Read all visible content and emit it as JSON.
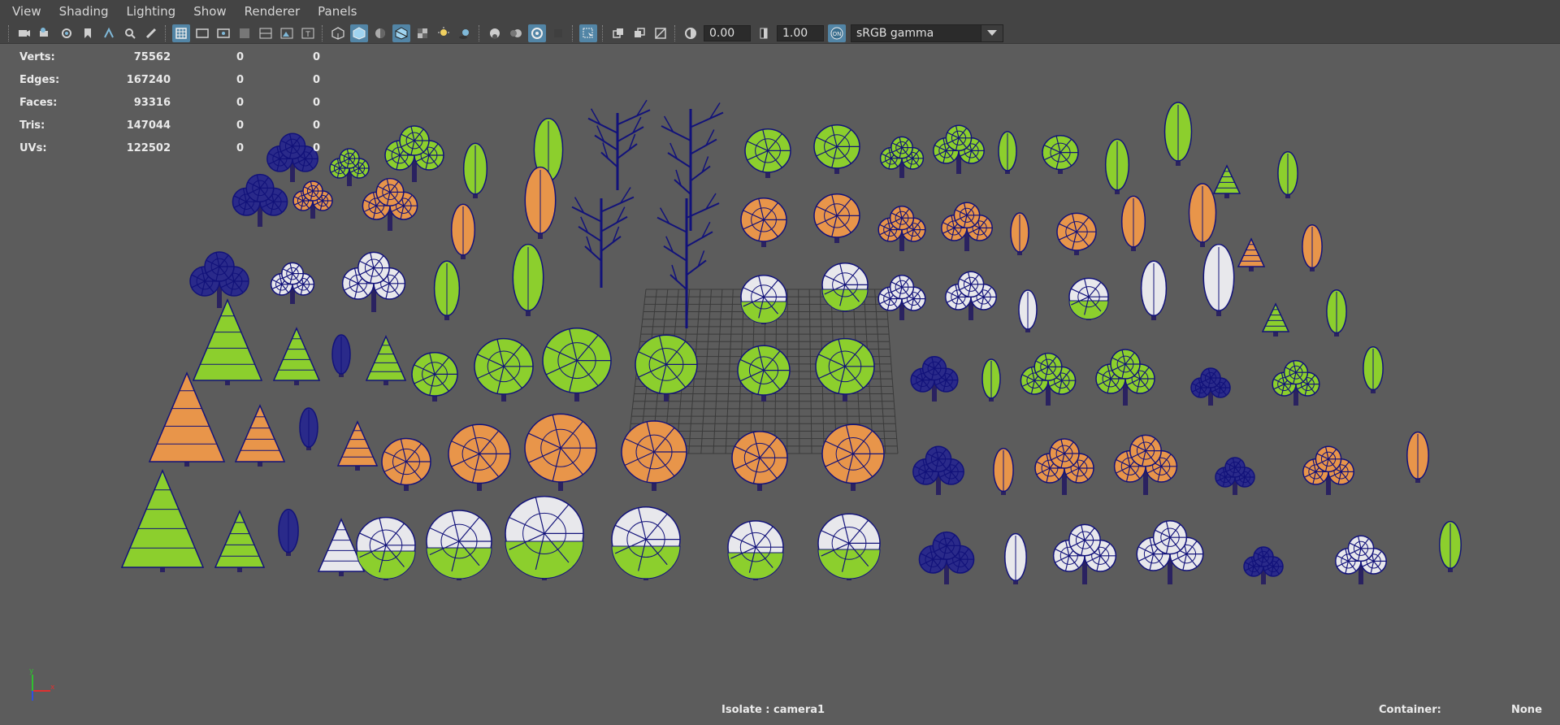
{
  "menu": [
    "View",
    "Shading",
    "Lighting",
    "Show",
    "Renderer",
    "Panels"
  ],
  "toolbar": {
    "exposure_value": "0.00",
    "gamma_value": "1.00",
    "colorspace_label": "sRGB gamma"
  },
  "hud": {
    "rows": [
      {
        "label": "Verts:",
        "v1": "75562",
        "v2": "0",
        "v3": "0"
      },
      {
        "label": "Edges:",
        "v1": "167240",
        "v2": "0",
        "v3": "0"
      },
      {
        "label": "Faces:",
        "v1": "93316",
        "v2": "0",
        "v3": "0"
      },
      {
        "label": "Tris:",
        "v1": "147044",
        "v2": "0",
        "v3": "0"
      },
      {
        "label": "UVs:",
        "v1": "122502",
        "v2": "0",
        "v3": "0"
      }
    ]
  },
  "status": {
    "isolate": "Isolate : camera1",
    "container_label": "Container:",
    "container_value": "None"
  },
  "colors": {
    "viewport_bg": "#5c5c5c",
    "wire": "#12127a",
    "green": "#8ccf2d",
    "orange": "#e8954a",
    "white": "#e8e8ec",
    "trunk": "#2a2260",
    "active_tool": "#5285a6",
    "grid": "#3a3a3a"
  },
  "axis_labels": {
    "x": "x",
    "y": "y"
  }
}
